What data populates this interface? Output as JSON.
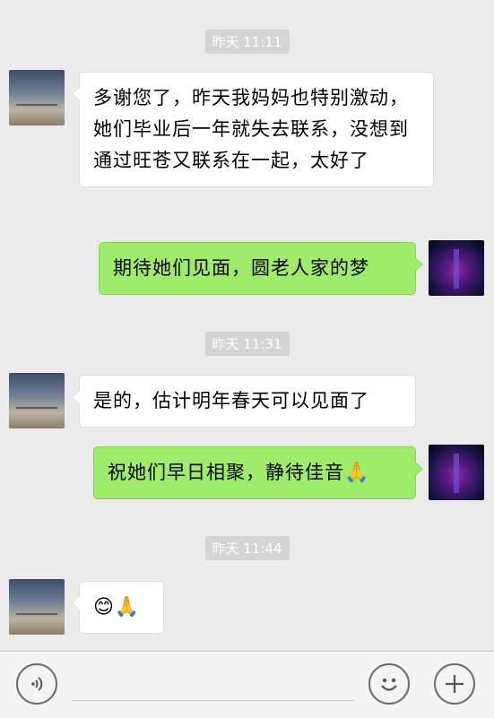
{
  "timestamps": [
    "昨天 11:11",
    "昨天 11:31",
    "昨天 11:44"
  ],
  "messages": [
    {
      "sender": "them",
      "text": "多谢您了，昨天我妈妈也特别激动，她们毕业后一年就失去联系，没想到通过旺苍又联系在一起，太好了"
    },
    {
      "sender": "me",
      "text": "期待她们见面，圆老人家的梦"
    },
    {
      "sender": "them",
      "text": "是的，估计明年春天可以见面了"
    },
    {
      "sender": "me",
      "text": "祝她们早日相聚，静待佳音",
      "emoji": "🙏"
    },
    {
      "sender": "them",
      "text": "",
      "emoji": "😊🙏"
    }
  ],
  "input_bar": {
    "voice_button_icon": "voice-icon",
    "emoji_button_icon": "smiley-icon",
    "more_button_icon": "plus-icon"
  }
}
